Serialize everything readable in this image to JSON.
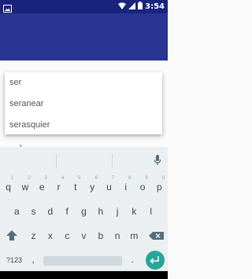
{
  "status_bar": {
    "time": "3:54"
  },
  "suggestions": [
    "ser",
    "seranear",
    "serasquier"
  ],
  "input": {
    "value": "ser"
  },
  "keyboard": {
    "row1": [
      {
        "key": "q",
        "hint": "1"
      },
      {
        "key": "w",
        "hint": "2"
      },
      {
        "key": "e",
        "hint": "3"
      },
      {
        "key": "r",
        "hint": "4"
      },
      {
        "key": "t",
        "hint": "5"
      },
      {
        "key": "y",
        "hint": "6"
      },
      {
        "key": "u",
        "hint": "7"
      },
      {
        "key": "i",
        "hint": "8"
      },
      {
        "key": "o",
        "hint": "9"
      },
      {
        "key": "p",
        "hint": "0"
      }
    ],
    "row2": [
      "a",
      "s",
      "d",
      "f",
      "g",
      "h",
      "j",
      "k",
      "l"
    ],
    "row3": [
      "z",
      "x",
      "c",
      "v",
      "b",
      "n",
      "m"
    ],
    "symbols_label": "?123",
    "comma": ",",
    "period": ".",
    "icons": [
      "shift-icon",
      "backspace-icon",
      "enter-icon",
      "mic-icon"
    ]
  },
  "colors": {
    "status_bar": "#1a237e",
    "app_bar": "#283593",
    "accent": "#009688",
    "enter_key": "#26a69a"
  }
}
